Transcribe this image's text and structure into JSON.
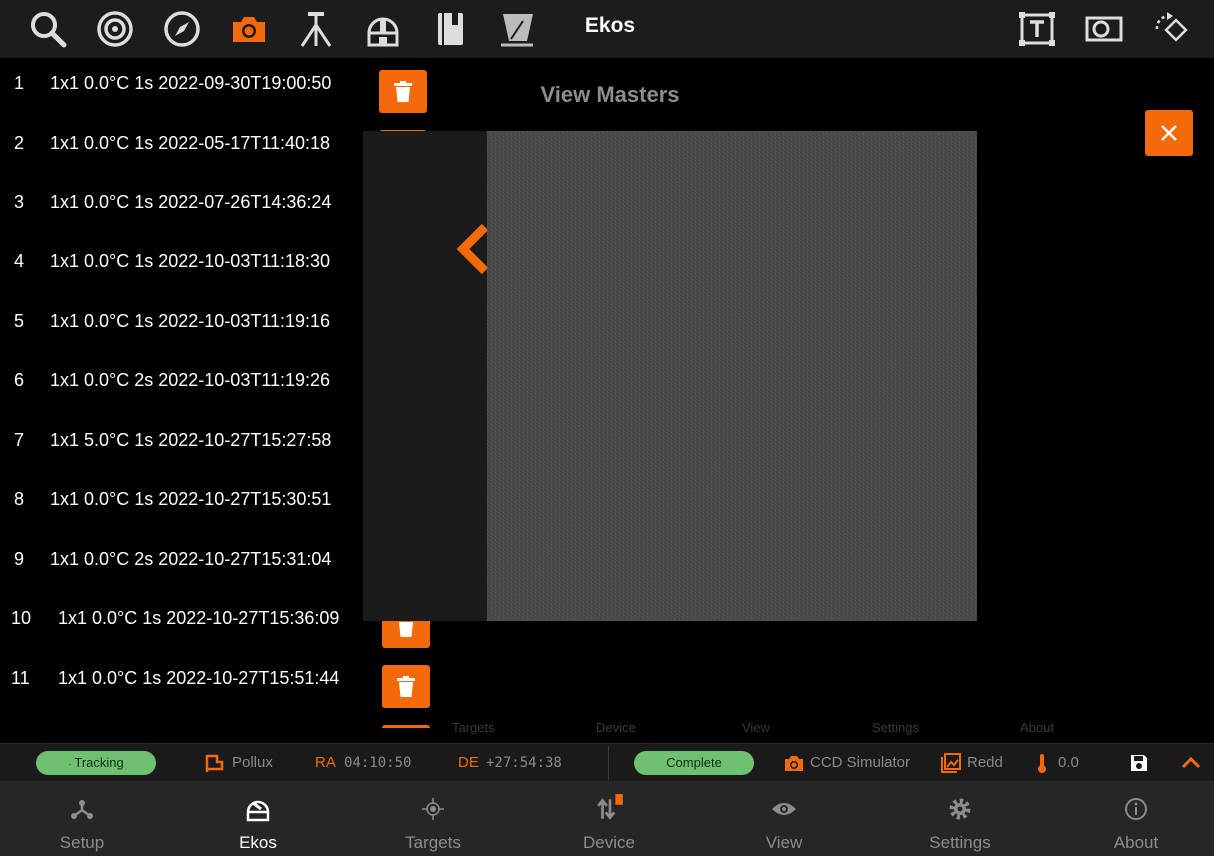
{
  "app": {
    "title": "Ekos",
    "accent_color": "#f46a0a",
    "toolbar_icons": [
      "search-icon",
      "target-icon",
      "compass-icon",
      "camera-icon",
      "tripod-icon",
      "observatory-dome-icon",
      "notebook-icon",
      "scope-icon"
    ],
    "active_toolbar_icon": "camera-icon",
    "right_toolbar_icons": [
      "text-frame-icon",
      "frame-icon",
      "rotate-icon"
    ]
  },
  "masters": {
    "title": "View Masters",
    "rows": [
      {
        "index": "1",
        "desc": "1x1 0.0°C 1s 2022-09-30T19:00:50"
      },
      {
        "index": "2",
        "desc": "1x1 0.0°C 1s 2022-05-17T11:40:18"
      },
      {
        "index": "3",
        "desc": "1x1 0.0°C 1s 2022-07-26T14:36:24"
      },
      {
        "index": "4",
        "desc": "1x1 0.0°C 1s 2022-10-03T11:18:30"
      },
      {
        "index": "5",
        "desc": "1x1 0.0°C 1s 2022-10-03T11:19:16"
      },
      {
        "index": "6",
        "desc": "1x1 0.0°C 2s 2022-10-03T11:19:26"
      },
      {
        "index": "7",
        "desc": "1x1 5.0°C 1s 2022-10-27T15:27:58"
      },
      {
        "index": "8",
        "desc": "1x1 0.0°C 1s 2022-10-27T15:30:51"
      },
      {
        "index": "9",
        "desc": "1x1 0.0°C 2s 2022-10-27T15:31:04"
      },
      {
        "index": "10",
        "desc": "1x1 0.0°C 1s 2022-10-27T15:36:09"
      },
      {
        "index": "11",
        "desc": "1x1 0.0°C 1s 2022-10-27T15:51:44"
      }
    ]
  },
  "ghost_tabs": [
    "Targets",
    "Device",
    "View",
    "Settings",
    "About"
  ],
  "status": {
    "tracking_label": "Tracking",
    "target_name": "Pollux",
    "ra_label": "RA",
    "ra_value": "04:10:50",
    "de_label": "DE",
    "de_value": "+27:54:38",
    "capture_status": "Complete",
    "camera_name": "CCD Simulator",
    "filter_name": "Redd",
    "temperature": "0.0"
  },
  "nav": {
    "active": "Ekos",
    "items": [
      {
        "label": "Setup",
        "icon": "setup-icon"
      },
      {
        "label": "Ekos",
        "icon": "ekos-dome-icon"
      },
      {
        "label": "Targets",
        "icon": "targets-icon"
      },
      {
        "label": "Device",
        "icon": "device-icon"
      },
      {
        "label": "View",
        "icon": "eye-icon"
      },
      {
        "label": "Settings",
        "icon": "gear-icon"
      },
      {
        "label": "About",
        "icon": "info-icon"
      }
    ]
  }
}
